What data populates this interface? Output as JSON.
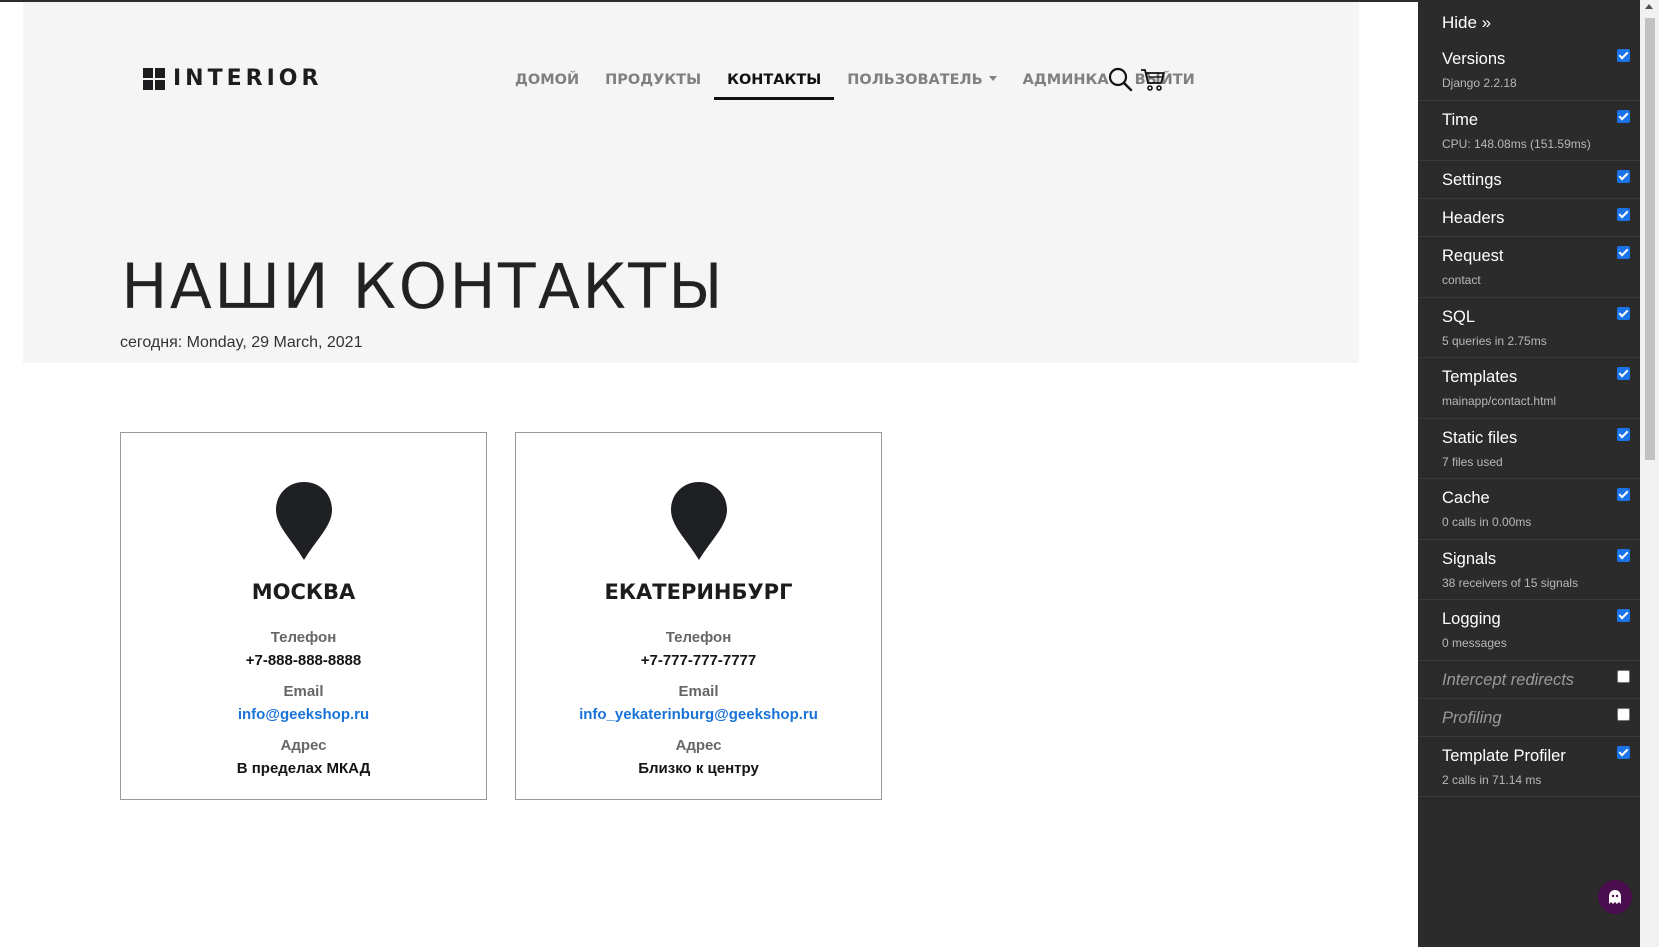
{
  "site": {
    "logo": "INTERIOR",
    "nav": [
      {
        "label": "ДОМОЙ",
        "active": false
      },
      {
        "label": "ПРОДУКТЫ",
        "active": false
      },
      {
        "label": "КОНТАКТЫ",
        "active": true
      },
      {
        "label": "ПОЛЬЗОВАТЕЛЬ",
        "active": false,
        "dropdown": true
      },
      {
        "label": "АДМИНКА",
        "active": false
      },
      {
        "label": "ВЫЙТИ",
        "active": false
      }
    ],
    "icons": [
      "search-icon",
      "cart-icon"
    ]
  },
  "page": {
    "title": "НАШИ КОНТАКТЫ",
    "date_line": "сегодня: Monday, 29 March, 2021"
  },
  "contacts": [
    {
      "city": "МОСКВА",
      "phone_label": "Телефон",
      "phone": "+7-888-888-8888",
      "email_label": "Email",
      "email": "info@geekshop.ru",
      "address_label": "Адрес",
      "address": "В пределах МКАД"
    },
    {
      "city": "ЕКАТЕРИНБУРГ",
      "phone_label": "Телефон",
      "phone": "+7-777-777-7777",
      "email_label": "Email",
      "email": "info_yekaterinburg@geekshop.ru",
      "address_label": "Адрес",
      "address": "Близко к центру"
    }
  ],
  "debug_toolbar": {
    "hide_label": "Hide »",
    "panels": [
      {
        "title": "Versions",
        "subtitle": "Django 2.2.18",
        "enabled": true
      },
      {
        "title": "Time",
        "subtitle": "CPU: 148.08ms (151.59ms)",
        "enabled": true
      },
      {
        "title": "Settings",
        "subtitle": "",
        "enabled": true
      },
      {
        "title": "Headers",
        "subtitle": "",
        "enabled": true
      },
      {
        "title": "Request",
        "subtitle": "contact",
        "enabled": true
      },
      {
        "title": "SQL",
        "subtitle": "5 queries in 2.75ms",
        "enabled": true
      },
      {
        "title": "Templates",
        "subtitle": "mainapp/contact.html",
        "enabled": true
      },
      {
        "title": "Static files",
        "subtitle": "7 files used",
        "enabled": true
      },
      {
        "title": "Cache",
        "subtitle": "0 calls in 0.00ms",
        "enabled": true
      },
      {
        "title": "Signals",
        "subtitle": "38 receivers of 15 signals",
        "enabled": true
      },
      {
        "title": "Logging",
        "subtitle": "0 messages",
        "enabled": true
      },
      {
        "title": "Intercept redirects",
        "subtitle": "",
        "enabled": false
      },
      {
        "title": "Profiling",
        "subtitle": "",
        "enabled": false
      },
      {
        "title": "Template Profiler",
        "subtitle": "2 calls in 71.14 ms",
        "enabled": true
      }
    ]
  },
  "colors": {
    "hero_bg": "#f5f5f5",
    "text_dark": "#1d1d1f",
    "nav_muted": "#808080",
    "link": "#1a73d9",
    "debug_bg": "#2b2b2b",
    "checkbox": "#1a73e8"
  }
}
